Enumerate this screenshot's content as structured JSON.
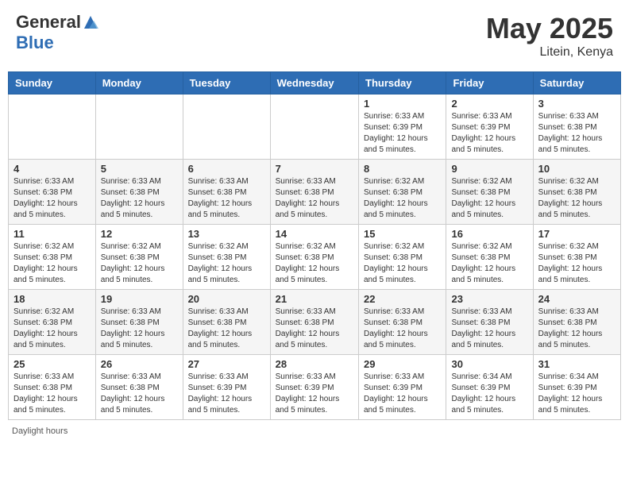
{
  "header": {
    "logo_general": "General",
    "logo_blue": "Blue",
    "month_year": "May 2025",
    "location": "Litein, Kenya"
  },
  "weekdays": [
    "Sunday",
    "Monday",
    "Tuesday",
    "Wednesday",
    "Thursday",
    "Friday",
    "Saturday"
  ],
  "footer": {
    "daylight_label": "Daylight hours"
  },
  "weeks": [
    [
      {
        "day": "",
        "info": ""
      },
      {
        "day": "",
        "info": ""
      },
      {
        "day": "",
        "info": ""
      },
      {
        "day": "",
        "info": ""
      },
      {
        "day": "1",
        "info": "Sunrise: 6:33 AM\nSunset: 6:39 PM\nDaylight: 12 hours and 5 minutes."
      },
      {
        "day": "2",
        "info": "Sunrise: 6:33 AM\nSunset: 6:39 PM\nDaylight: 12 hours and 5 minutes."
      },
      {
        "day": "3",
        "info": "Sunrise: 6:33 AM\nSunset: 6:38 PM\nDaylight: 12 hours and 5 minutes."
      }
    ],
    [
      {
        "day": "4",
        "info": "Sunrise: 6:33 AM\nSunset: 6:38 PM\nDaylight: 12 hours and 5 minutes."
      },
      {
        "day": "5",
        "info": "Sunrise: 6:33 AM\nSunset: 6:38 PM\nDaylight: 12 hours and 5 minutes."
      },
      {
        "day": "6",
        "info": "Sunrise: 6:33 AM\nSunset: 6:38 PM\nDaylight: 12 hours and 5 minutes."
      },
      {
        "day": "7",
        "info": "Sunrise: 6:33 AM\nSunset: 6:38 PM\nDaylight: 12 hours and 5 minutes."
      },
      {
        "day": "8",
        "info": "Sunrise: 6:32 AM\nSunset: 6:38 PM\nDaylight: 12 hours and 5 minutes."
      },
      {
        "day": "9",
        "info": "Sunrise: 6:32 AM\nSunset: 6:38 PM\nDaylight: 12 hours and 5 minutes."
      },
      {
        "day": "10",
        "info": "Sunrise: 6:32 AM\nSunset: 6:38 PM\nDaylight: 12 hours and 5 minutes."
      }
    ],
    [
      {
        "day": "11",
        "info": "Sunrise: 6:32 AM\nSunset: 6:38 PM\nDaylight: 12 hours and 5 minutes."
      },
      {
        "day": "12",
        "info": "Sunrise: 6:32 AM\nSunset: 6:38 PM\nDaylight: 12 hours and 5 minutes."
      },
      {
        "day": "13",
        "info": "Sunrise: 6:32 AM\nSunset: 6:38 PM\nDaylight: 12 hours and 5 minutes."
      },
      {
        "day": "14",
        "info": "Sunrise: 6:32 AM\nSunset: 6:38 PM\nDaylight: 12 hours and 5 minutes."
      },
      {
        "day": "15",
        "info": "Sunrise: 6:32 AM\nSunset: 6:38 PM\nDaylight: 12 hours and 5 minutes."
      },
      {
        "day": "16",
        "info": "Sunrise: 6:32 AM\nSunset: 6:38 PM\nDaylight: 12 hours and 5 minutes."
      },
      {
        "day": "17",
        "info": "Sunrise: 6:32 AM\nSunset: 6:38 PM\nDaylight: 12 hours and 5 minutes."
      }
    ],
    [
      {
        "day": "18",
        "info": "Sunrise: 6:32 AM\nSunset: 6:38 PM\nDaylight: 12 hours and 5 minutes."
      },
      {
        "day": "19",
        "info": "Sunrise: 6:33 AM\nSunset: 6:38 PM\nDaylight: 12 hours and 5 minutes."
      },
      {
        "day": "20",
        "info": "Sunrise: 6:33 AM\nSunset: 6:38 PM\nDaylight: 12 hours and 5 minutes."
      },
      {
        "day": "21",
        "info": "Sunrise: 6:33 AM\nSunset: 6:38 PM\nDaylight: 12 hours and 5 minutes."
      },
      {
        "day": "22",
        "info": "Sunrise: 6:33 AM\nSunset: 6:38 PM\nDaylight: 12 hours and 5 minutes."
      },
      {
        "day": "23",
        "info": "Sunrise: 6:33 AM\nSunset: 6:38 PM\nDaylight: 12 hours and 5 minutes."
      },
      {
        "day": "24",
        "info": "Sunrise: 6:33 AM\nSunset: 6:38 PM\nDaylight: 12 hours and 5 minutes."
      }
    ],
    [
      {
        "day": "25",
        "info": "Sunrise: 6:33 AM\nSunset: 6:38 PM\nDaylight: 12 hours and 5 minutes."
      },
      {
        "day": "26",
        "info": "Sunrise: 6:33 AM\nSunset: 6:38 PM\nDaylight: 12 hours and 5 minutes."
      },
      {
        "day": "27",
        "info": "Sunrise: 6:33 AM\nSunset: 6:39 PM\nDaylight: 12 hours and 5 minutes."
      },
      {
        "day": "28",
        "info": "Sunrise: 6:33 AM\nSunset: 6:39 PM\nDaylight: 12 hours and 5 minutes."
      },
      {
        "day": "29",
        "info": "Sunrise: 6:33 AM\nSunset: 6:39 PM\nDaylight: 12 hours and 5 minutes."
      },
      {
        "day": "30",
        "info": "Sunrise: 6:34 AM\nSunset: 6:39 PM\nDaylight: 12 hours and 5 minutes."
      },
      {
        "day": "31",
        "info": "Sunrise: 6:34 AM\nSunset: 6:39 PM\nDaylight: 12 hours and 5 minutes."
      }
    ]
  ]
}
